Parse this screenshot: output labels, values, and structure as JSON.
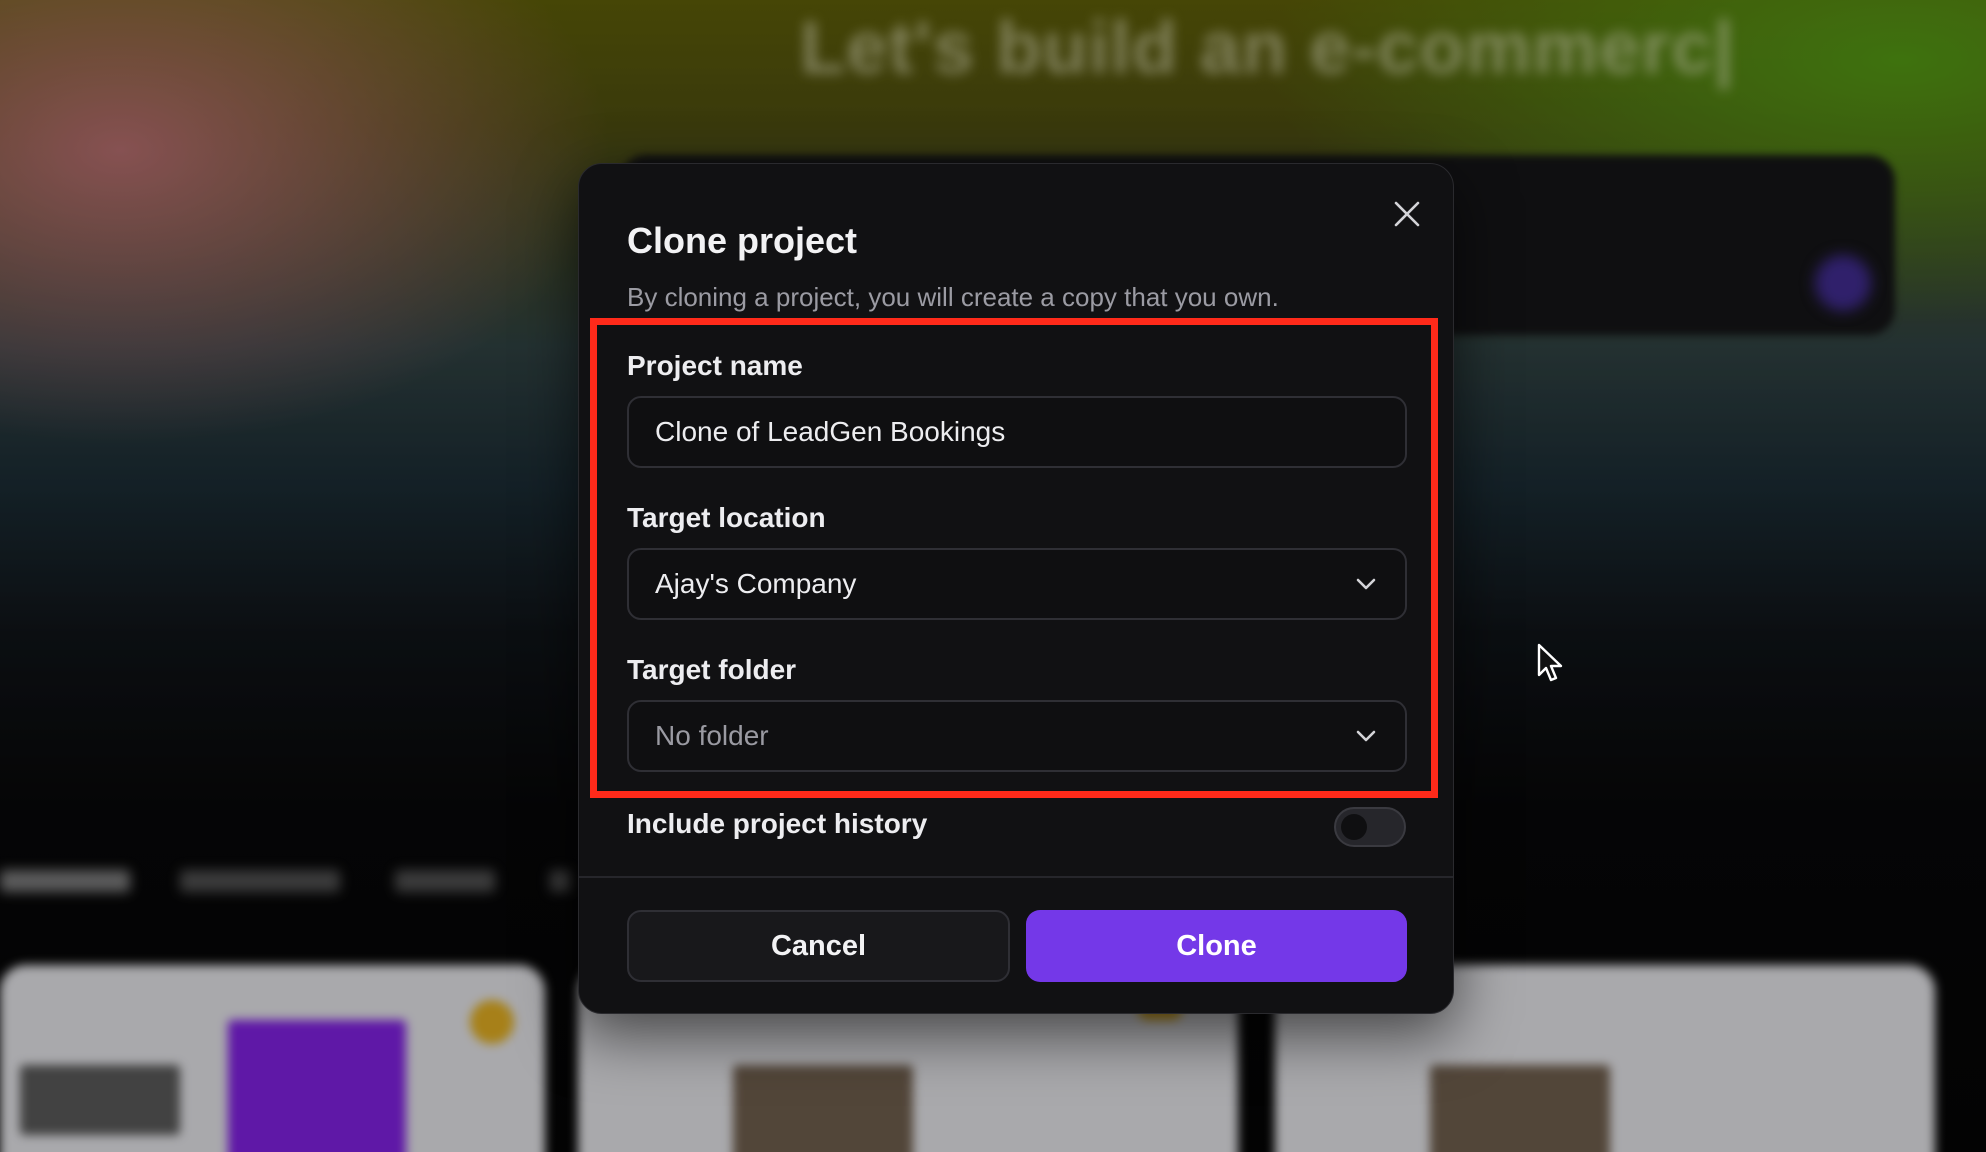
{
  "background": {
    "headline": "Let's build an e-commerc|",
    "tabs": [
      "Recently viewed",
      "My projects",
      "Starred",
      "Templates"
    ]
  },
  "dialog": {
    "title": "Clone project",
    "subtitle": "By cloning a project, you will create a copy that you own.",
    "close_icon": "close-icon",
    "project_name": {
      "label": "Project name",
      "value": "Clone of LeadGen Bookings"
    },
    "target_location": {
      "label": "Target location",
      "selected": "Ajay's Company",
      "icon": "chevron-down-icon"
    },
    "target_folder": {
      "label": "Target folder",
      "selected": "No folder",
      "icon": "chevron-down-icon"
    },
    "history": {
      "label": "Include project history",
      "enabled": false
    },
    "buttons": {
      "cancel": "Cancel",
      "clone": "Clone"
    }
  },
  "colors": {
    "accent": "#7438e8",
    "highlight": "#ff2a1a",
    "dialog_bg": "#111113"
  }
}
